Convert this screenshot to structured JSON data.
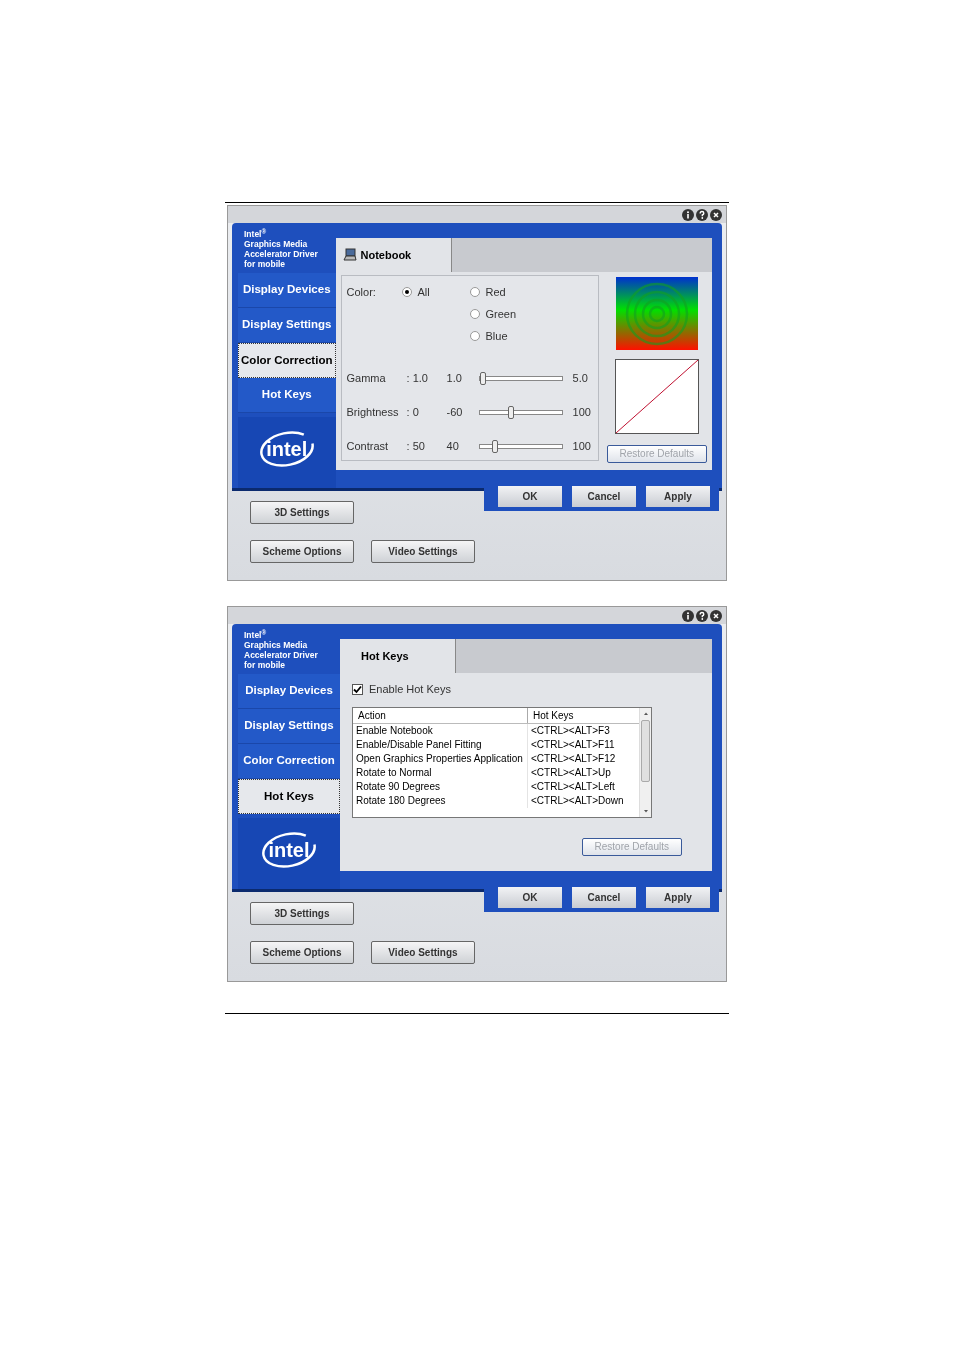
{
  "windows": [
    {
      "header": [
        "Intel$^{®}$",
        "Graphics Media",
        "Accelerator Driver",
        "for mobile"
      ],
      "nav": [
        {
          "label": "Display Devices",
          "selected": false
        },
        {
          "label": "Display Settings",
          "selected": false
        },
        {
          "label": "Color Correction",
          "selected": true
        },
        {
          "label": "Hot Keys",
          "selected": false
        }
      ],
      "logo": "intel",
      "tab": {
        "label": "Notebook",
        "kind": "device"
      },
      "panel": {
        "kind": "color_correction",
        "color_label": "Color:",
        "radios": [
          {
            "label": "All",
            "selected": true
          },
          {
            "label": "Red",
            "selected": false
          },
          {
            "label": "Green",
            "selected": false
          },
          {
            "label": "Blue",
            "selected": false
          }
        ],
        "sliders": [
          {
            "name": "Gamma",
            "value": ": 1.0",
            "min": "1.0",
            "max": "5.0",
            "level": 0
          },
          {
            "name": "Brightness",
            "value": ": 0",
            "min": "-60",
            "max": "100",
            "level": 0.375
          },
          {
            "name": "Contrast",
            "value": ": 50",
            "min": "40",
            "max": "100",
            "level": 0.167
          }
        ],
        "restore": {
          "label": "Restore Defaults",
          "disabled": true
        }
      },
      "dialog_buttons": [
        "OK",
        "Cancel",
        "Apply"
      ],
      "bottom_buttons": [
        "3D Settings",
        "Scheme Options",
        "Video Settings"
      ]
    },
    {
      "header": [
        "Intel$^{®}$",
        "Graphics Media",
        "Accelerator Driver",
        "for mobile"
      ],
      "nav": [
        {
          "label": "Display Devices",
          "selected": false
        },
        {
          "label": "Display Settings",
          "selected": false
        },
        {
          "label": "Color Correction",
          "selected": false
        },
        {
          "label": "Hot Keys",
          "selected": true
        }
      ],
      "logo": "intel",
      "tab": {
        "label": "Hot Keys",
        "kind": "plain"
      },
      "panel": {
        "kind": "hot_keys",
        "checkbox": {
          "label": "Enable Hot Keys",
          "checked": true
        },
        "columns": [
          "Action",
          "Hot Keys"
        ],
        "rows": [
          [
            "Enable Notebook",
            "<CTRL><ALT>F3"
          ],
          [
            "Enable/Disable Panel Fitting",
            "<CTRL><ALT>F11"
          ],
          [
            "Open Graphics Properties Application",
            "<CTRL><ALT>F12"
          ],
          [
            "Rotate to Normal",
            "<CTRL><ALT>Up"
          ],
          [
            "Rotate 90 Degrees",
            "<CTRL><ALT>Left"
          ],
          [
            "Rotate 180 Degrees",
            "<CTRL><ALT>Down"
          ]
        ],
        "restore": {
          "label": "Restore Defaults",
          "disabled": true
        }
      },
      "dialog_buttons": [
        "OK",
        "Cancel",
        "Apply"
      ],
      "bottom_buttons": [
        "3D Settings",
        "Scheme Options",
        "Video Settings"
      ]
    }
  ]
}
